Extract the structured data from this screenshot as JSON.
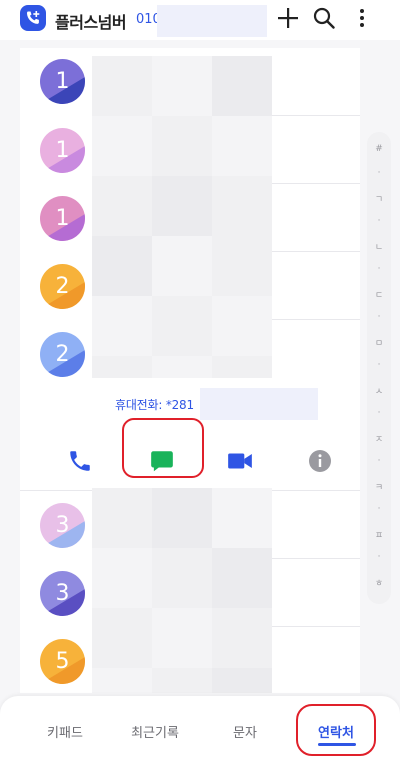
{
  "header": {
    "title": "플러스넘버",
    "number_prefix": "010"
  },
  "contacts": [
    {
      "initial": "1",
      "color": "#7c6fd8",
      "color2": "#3b45b8"
    },
    {
      "initial": "1",
      "color": "#e9b0e0",
      "color2": "#c98adf"
    },
    {
      "initial": "1",
      "color": "#e08fc2",
      "color2": "#b56cd3"
    },
    {
      "initial": "2",
      "color": "#f7b23a",
      "color2": "#f0992a"
    },
    {
      "initial": "2",
      "color": "#8fb0f5",
      "color2": "#5c7ee8"
    },
    {
      "initial": "3",
      "color": "#e8c0e8",
      "color2": "#9db5f0"
    },
    {
      "initial": "3",
      "color": "#8f8ae0",
      "color2": "#5a4fc2"
    },
    {
      "initial": "5",
      "color": "#f7b23a",
      "color2": "#f0992a"
    }
  ],
  "detail": {
    "phone_label": "휴대전화: *281"
  },
  "index": [
    "#",
    "·",
    "ㄱ",
    "·",
    "ㄴ",
    "·",
    "ㄷ",
    "·",
    "ㅁ",
    "·",
    "ㅅ",
    "·",
    "ㅈ",
    "·",
    "ㅋ",
    "·",
    "ㅍ",
    "·",
    "ㅎ"
  ],
  "bottom_nav": [
    {
      "label": "키패드"
    },
    {
      "label": "최근기록"
    },
    {
      "label": "문자"
    },
    {
      "label": "연락처"
    }
  ],
  "colors": {
    "accent": "#2f55e4",
    "call": "#2f55e4",
    "message": "#19b35a",
    "video": "#2f55e4",
    "info": "#9a9aa0",
    "highlight": "#e0202a"
  }
}
